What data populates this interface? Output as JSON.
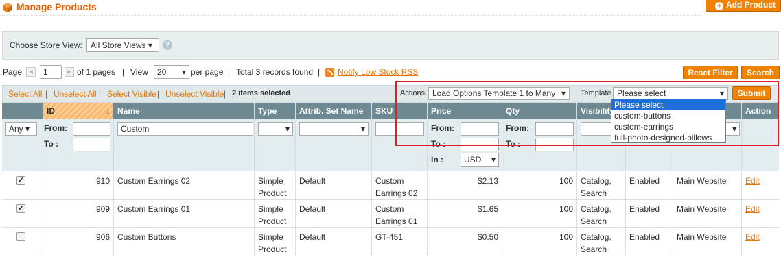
{
  "header": {
    "title": "Manage Products",
    "add_button": "Add Product"
  },
  "store": {
    "label": "Choose Store View:",
    "value": "All Store Views",
    "help_icon": "?"
  },
  "pager": {
    "page_label": "Page",
    "page_value": "1",
    "of_pages": "of 1 pages",
    "sep1": "|",
    "view_label": "View",
    "view_value": "20",
    "per_page": "per page",
    "sep2": "|",
    "records": "Total 3 records found",
    "sep3": "|",
    "rss_link": "Notify Low Stock RSS"
  },
  "buttons": {
    "reset": "Reset Filter",
    "search": "Search",
    "submit": "Submit"
  },
  "massaction": {
    "select_all": "Select All",
    "unselect_all": "Unselect All",
    "select_visible": "Select Visible",
    "unselect_visible": "Unselect Visible",
    "sep": "|",
    "selected": "2 items selected",
    "actions_label": "Actions",
    "actions_value": "Load Options Template 1 to Many",
    "template_label": "Template",
    "template_value": "Please select",
    "template_options": [
      "Please select",
      "custom-buttons",
      "custom-earrings",
      "full-photo-designed-pillows"
    ]
  },
  "columns": [
    "ID",
    "Name",
    "Type",
    "Attrib. Set Name",
    "SKU",
    "Price",
    "Qty",
    "Visibility",
    "Action"
  ],
  "filters": {
    "any": "Any",
    "from": "From:",
    "to": "To :",
    "name": "Custom",
    "in": "In :",
    "currency": "USD"
  },
  "rows": [
    {
      "checked": true,
      "id": "910",
      "name": "Custom Earrings 02",
      "type": "Simple Product",
      "attr": "Default",
      "sku": "Custom Earrings 02",
      "price": "$2.13",
      "qty": "100",
      "visibility": "Catalog, Search",
      "status": "Enabled",
      "website": "Main Website",
      "action": "Edit"
    },
    {
      "checked": true,
      "id": "909",
      "name": "Custom Earrings 01",
      "type": "Simple Product",
      "attr": "Default",
      "sku": "Custom Earrings 01",
      "price": "$1.65",
      "qty": "100",
      "visibility": "Catalog, Search",
      "status": "Enabled",
      "website": "Main Website",
      "action": "Edit"
    },
    {
      "checked": false,
      "id": "906",
      "name": "Custom Buttons",
      "type": "Simple Product",
      "attr": "Default",
      "sku": "GT-451",
      "price": "$0.50",
      "qty": "100",
      "visibility": "Catalog, Search",
      "status": "Enabled",
      "website": "Main Website",
      "action": "Edit"
    }
  ],
  "colors": {
    "accent": "#eb5e00",
    "button": "#f18200",
    "header_bg": "#6f8992",
    "highlight": "#e02020"
  }
}
